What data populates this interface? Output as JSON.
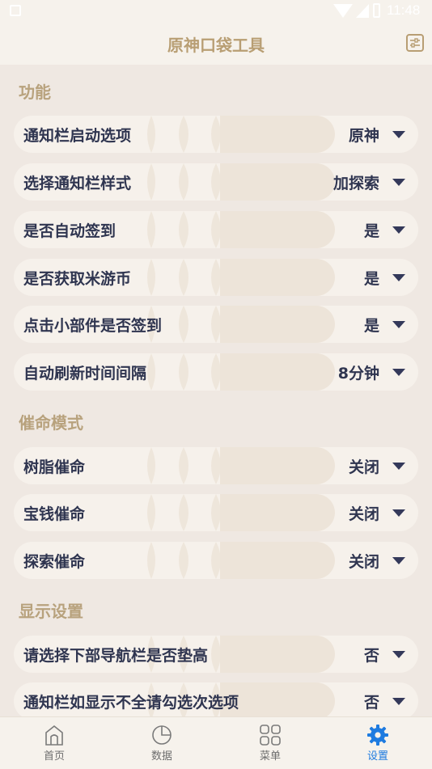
{
  "status_bar": {
    "time": "11:48"
  },
  "app_bar": {
    "title": "原神口袋工具",
    "filter_icon": "sliders-icon"
  },
  "sections": [
    {
      "title": "功能",
      "rows": [
        {
          "label": "通知栏启动选项",
          "value": "原神"
        },
        {
          "label": "选择通知栏样式",
          "value": "加探索"
        },
        {
          "label": "是否自动签到",
          "value": "是"
        },
        {
          "label": "是否获取米游币",
          "value": "是"
        },
        {
          "label": "点击小部件是否签到",
          "value": "是"
        },
        {
          "label": "自动刷新时间间隔",
          "value": "8分钟"
        }
      ]
    },
    {
      "title": "催命模式",
      "rows": [
        {
          "label": "树脂催命",
          "value": "关闭"
        },
        {
          "label": "宝钱催命",
          "value": "关闭"
        },
        {
          "label": "探索催命",
          "value": "关闭"
        }
      ]
    },
    {
      "title": "显示设置",
      "rows": [
        {
          "label": "请选择下部导航栏是否垫高",
          "value": "否"
        },
        {
          "label": "通知栏如显示不全请勾选次选项",
          "value": "否"
        }
      ]
    }
  ],
  "bottom_nav": {
    "items": [
      {
        "label": "首页",
        "icon": "home-icon"
      },
      {
        "label": "数据",
        "icon": "pie-chart-icon"
      },
      {
        "label": "菜单",
        "icon": "grid-menu-icon"
      },
      {
        "label": "设置",
        "icon": "gear-icon"
      }
    ],
    "active_index": 3,
    "active_color": "#1e7be0",
    "inactive_color": "#6d6d6d"
  },
  "colors": {
    "accent": "#b89e73",
    "section_title": "#b8a27d",
    "row_text": "#2f3550",
    "background": "#efe8e2"
  }
}
